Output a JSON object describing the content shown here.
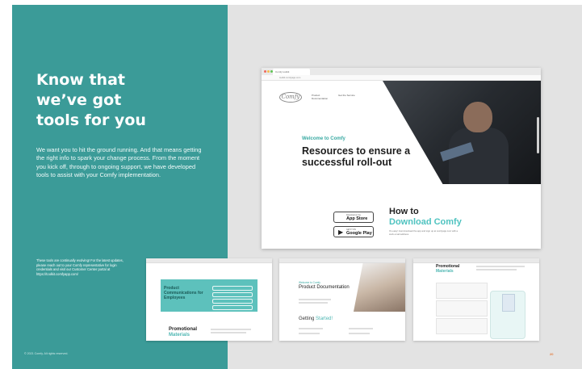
{
  "left_panel": {
    "heading_lines": [
      "Know that",
      "we’ve got",
      "tools for you"
    ],
    "intro": "We want you to hit the ground running. And that means getting the right info to spark your change process. From the moment you kick off, through to ongoing support, we have developed tools to assist with your Comfy implementation.",
    "note": "These tools are continually evolving! For the latest updates, please reach out to your Comfy representative for login credentials and visit our Customer Center portal at https://toolkit.comfyapp.com/",
    "copyright": "© 2021 Comfy. All rights reserved.",
    "page_number": "20"
  },
  "browser": {
    "tab_title": "Comfy toolkit",
    "url": "toolkit.comfyapp.com",
    "logo": "Comfy",
    "nav": [
      "Product Documentation",
      "Get the Service"
    ],
    "welcome": "Welcome to Comfy",
    "headline": "Resources to ensure a successful roll-out",
    "how_to": "How to",
    "download": "Download Comfy",
    "download_text": "It's easy! Just download the app and sign up at comfyapp.com with a work email address.",
    "app_store": {
      "small": "Download on the",
      "big": "App Store"
    },
    "google_play": {
      "small": "GET IT ON",
      "big": "Google Play"
    }
  },
  "thumb1": {
    "band_title": "Product Communications for Employees",
    "promo_line1": "Promotional",
    "promo_line2": "Materials"
  },
  "thumb2": {
    "welcome": "Welcome to Comfy",
    "title": "Product Documentation",
    "getting": "Getting",
    "started": "Started!"
  },
  "thumb3": {
    "title_line1": "Promotional",
    "title_line2": "Materials"
  },
  "colors": {
    "teal": "#3b9b98",
    "accent": "#4fc3c0",
    "page_num": "#e37d3e"
  }
}
